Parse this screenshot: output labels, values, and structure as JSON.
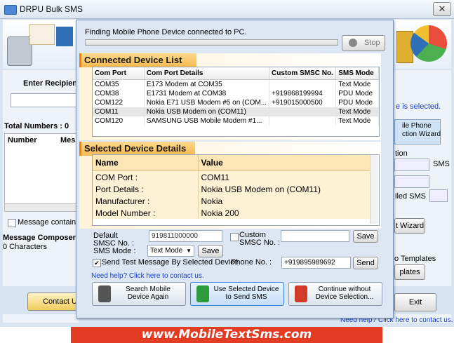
{
  "app": {
    "title": "DRPU Bulk SMS",
    "close_glyph": "✕"
  },
  "background": {
    "enter_recipient": "Enter Recipient",
    "total_numbers": "Total Numbers : 0",
    "col_number": "Number",
    "col_message": "Mess",
    "message_contains": "Message contains m",
    "message_composer": "Message Composer :",
    "characters": "0 Characters",
    "is_selected": "e is selected.",
    "mobile_phone_wizard_line1": "ile Phone",
    "mobile_phone_wizard_line2": "ction  Wizard",
    "tion": "tion",
    "sms": "SMS",
    "iled_sms": "iled SMS",
    "t_wizard": "t Wizard",
    "o_templates": "o Templates",
    "plates": "plates",
    "contact_us": "Contact U",
    "exit": "Exit",
    "need_help": "Need help? Click here to contact us."
  },
  "dialog": {
    "finding_text": "Finding Mobile Phone Device connected to PC.",
    "stop_button": "Stop",
    "connected_title": "Connected Device List",
    "port_headers": [
      "Com Port",
      "Com Port Details",
      "Custom SMSC No.",
      "SMS Mode"
    ],
    "ports": [
      {
        "port": "COM35",
        "details": "E173 Modem at COM35",
        "smsc": "",
        "mode": "Text Mode"
      },
      {
        "port": "COM38",
        "details": "E1731 Modem at COM38",
        "smsc": "+919868199994",
        "mode": "PDU Mode"
      },
      {
        "port": "COM122",
        "details": "Nokia E71 USB Modem #5 on (COM...",
        "smsc": "+919015000500",
        "mode": "PDU Mode"
      },
      {
        "port": "COM11",
        "details": "Nokia USB Modem on (COM11)",
        "smsc": "",
        "mode": "Text Mode"
      },
      {
        "port": "COM120",
        "details": "SAMSUNG USB Mobile Modem #1...",
        "smsc": "",
        "mode": "Text Mode"
      }
    ],
    "selected_title": "Selected Device Details",
    "detail_headers": [
      "Name",
      "Value"
    ],
    "details": [
      {
        "name": "COM Port :",
        "value": "COM11"
      },
      {
        "name": "Port Details :",
        "value": "Nokia USB Modem on (COM11)"
      },
      {
        "name": "Manufacturer :",
        "value": "Nokia"
      },
      {
        "name": "Model Number :",
        "value": "Nokia 200"
      }
    ],
    "default_smsc_label_1": "Default",
    "default_smsc_label_2": "SMSC No. :",
    "default_smsc_value": "919811000000",
    "custom_smsc_label_1": "Custom",
    "custom_smsc_label_2": "SMSC No. :",
    "custom_smsc_value": "",
    "save_label": "Save",
    "sms_mode_label": "SMS Mode :",
    "sms_mode_value": "Text Mode",
    "send_test_label": "Send Test Message By Selected Device",
    "phone_no_label": "Phone No. :",
    "phone_no_value": "+919895989692",
    "send_label": "Send",
    "help_link": "Need help? Click here to contact us.",
    "search_again_1": "Search Mobile",
    "search_again_2": "Device Again",
    "use_selected_1": "Use Selected Device",
    "use_selected_2": "to Send SMS",
    "continue_1": "Continue without",
    "continue_2": "Device Selection..."
  },
  "site_banner": "www.MobileTextSms.com"
}
